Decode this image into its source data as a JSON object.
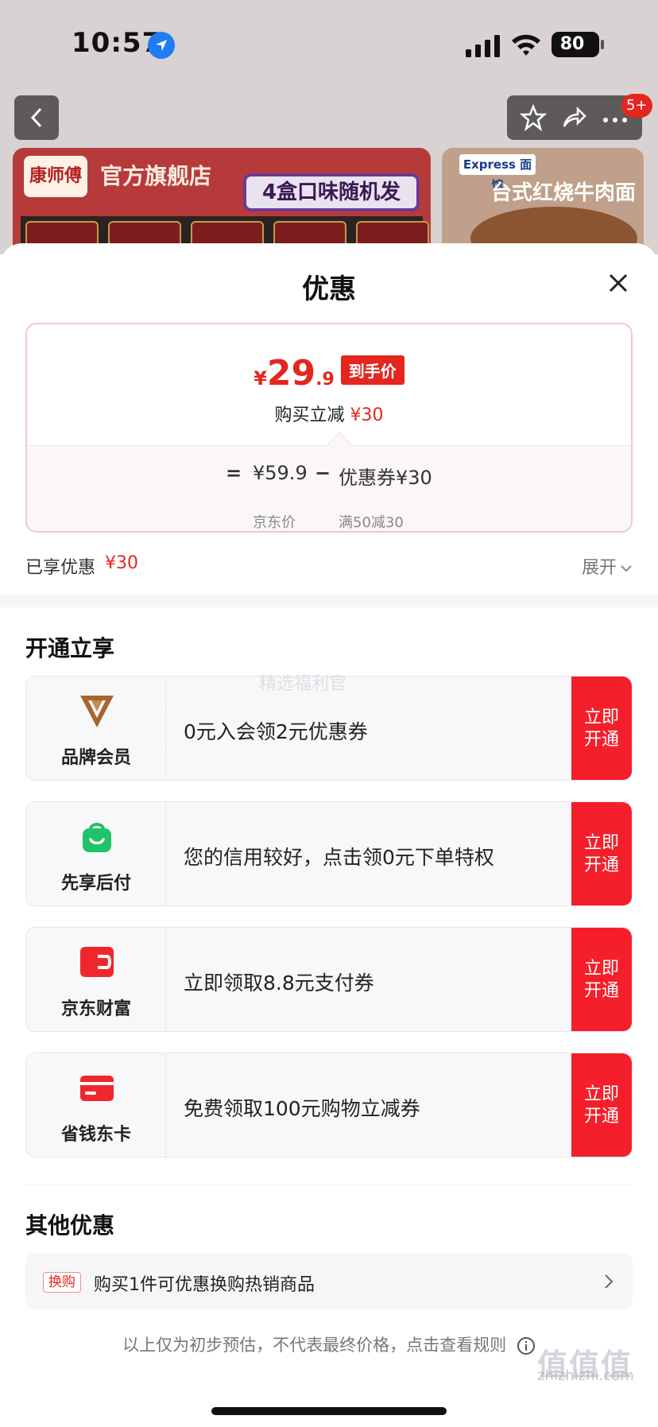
{
  "status_bar": {
    "time": "10:57",
    "battery": "80"
  },
  "nav": {
    "badge": "5+"
  },
  "banner": {
    "main_logo": "康师傅",
    "main_title": "官方旗舰店",
    "main_tag": "4盒口味随机发",
    "side_logo": "Express 面馆",
    "side_title": "台式红烧牛肉面"
  },
  "sheet": {
    "title": "优惠",
    "price": {
      "symbol": "¥",
      "integer": "29",
      "decimal": ".9",
      "badge": "到手价",
      "reduce_label": "购买立减",
      "reduce_amount": "¥30",
      "formula": {
        "equals": "=",
        "base_price": "¥59.9",
        "minus": "−",
        "coupon": "优惠券¥30",
        "base_label": "京东价",
        "coupon_rule": "满50减30"
      }
    },
    "enjoyed": {
      "label": "已享优惠",
      "amount": "¥30",
      "expand": "展开"
    },
    "open_section": {
      "title": "开通立享",
      "items": [
        {
          "name": "品牌会员",
          "desc": "0元入会领2元优惠券",
          "cta_line1": "立即",
          "cta_line2": "开通",
          "icon": "brand-v-icon",
          "color": "#a8652f"
        },
        {
          "name": "先享后付",
          "desc": "您的信用较好，点击领0元下单特权",
          "cta_line1": "立即",
          "cta_line2": "开通",
          "icon": "shopping-bag-icon",
          "color": "#1fc36a"
        },
        {
          "name": "京东财富",
          "desc": "立即领取8.8元支付券",
          "cta_line1": "立即",
          "cta_line2": "开通",
          "icon": "wallet-icon",
          "color": "#f0262d"
        },
        {
          "name": "省钱东卡",
          "desc": "免费领取100元购物立减券",
          "cta_line1": "立即",
          "cta_line2": "开通",
          "icon": "card-icon",
          "color": "#f0262d"
        }
      ]
    },
    "other_section": {
      "title": "其他优惠",
      "tag": "换购",
      "text": "购买1件可优惠换购热销商品"
    },
    "disclaimer": "以上仅为初步预估，不代表最终价格，点击查看规则"
  },
  "watermarks": {
    "overlay": "精选福利官",
    "site": "zhizhizhi.com",
    "logo": "值值值"
  },
  "colors": {
    "accent": "#e4261f",
    "cta": "#f41f2b"
  }
}
